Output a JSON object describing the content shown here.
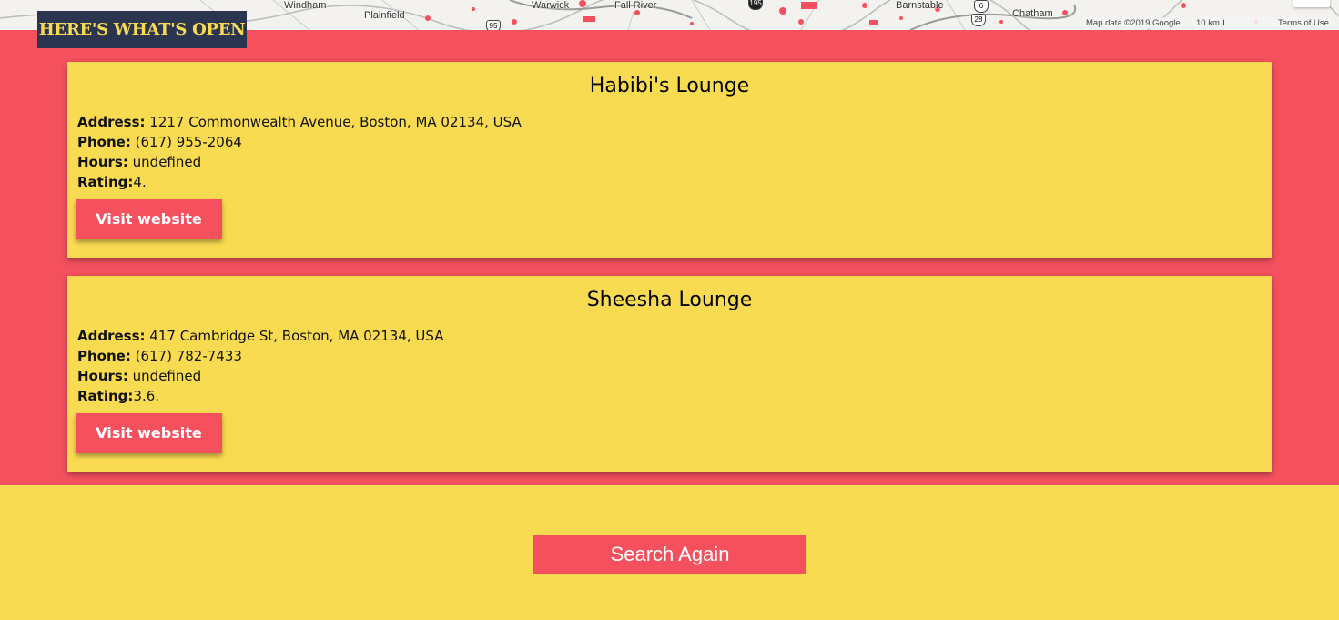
{
  "map": {
    "labels": {
      "windham": "Windham",
      "plainfield": "Plainfield",
      "warwick": "Warwick",
      "fall_river": "Fall River",
      "barnstable": "Barnstable",
      "chatham": "Chatham"
    },
    "shields": {
      "i95": "95",
      "i195": "195",
      "r6": "6",
      "r28": "28"
    },
    "attribution": "Map data ©2019 Google",
    "scale": "10 km",
    "terms": "Terms of Use"
  },
  "header": {
    "badge": "HERE'S WHAT'S OPEN"
  },
  "results": [
    {
      "name": "Habibi's Lounge",
      "address_label": "Address:",
      "address": "1217 Commonwealth Avenue, Boston, MA 02134, USA",
      "phone_label": "Phone:",
      "phone": "(617) 955-2064",
      "hours_label": "Hours:",
      "hours": "undefined",
      "rating_label": "Rating:",
      "rating": "4.",
      "button": "Visit website"
    },
    {
      "name": "Sheesha Lounge",
      "address_label": "Address:",
      "address": "417 Cambridge St, Boston, MA 02134, USA",
      "phone_label": "Phone:",
      "phone": "(617) 782-7433",
      "hours_label": "Hours:",
      "hours": "undefined",
      "rating_label": "Rating:",
      "rating": "3.6.",
      "button": "Visit website"
    }
  ],
  "footer": {
    "search_again": "Search Again"
  },
  "colors": {
    "accent_red": "#F4505E",
    "yellow": "#F9DB51",
    "navy": "#2C3550"
  }
}
